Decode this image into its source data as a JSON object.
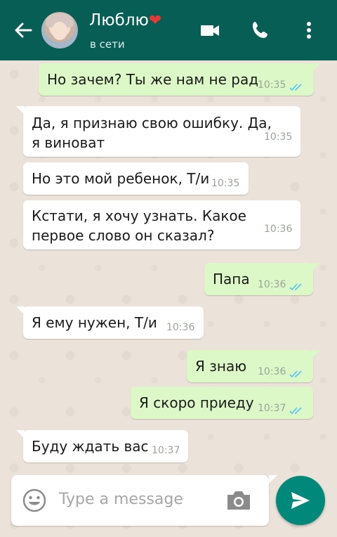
{
  "header": {
    "contact_name": "Люблю",
    "heart": "❤",
    "status": "в сети"
  },
  "messages": [
    {
      "dir": "out",
      "text": "Но зачем? Ты же нам не рад",
      "time": "10:35",
      "read": true
    },
    {
      "dir": "in",
      "text_lines": [
        "Да, я признаю свою ошибку. Да,",
        "я виноват"
      ],
      "time": "10:35"
    },
    {
      "dir": "in",
      "text": "Но это мой ребенок, Т/и",
      "time": "10:35"
    },
    {
      "dir": "in",
      "text_lines": [
        "Кстати, я хочу узнать. Какое",
        "первое слово он сказал?"
      ],
      "time": "10:36"
    },
    {
      "dir": "out",
      "text": "Папа",
      "time": "10:36",
      "read": true
    },
    {
      "dir": "in",
      "text": "Я ему нужен, Т/и",
      "time": "10:36"
    },
    {
      "dir": "out",
      "text": "Я знаю",
      "time": "10:36",
      "read": true
    },
    {
      "dir": "out",
      "text": "Я скоро приеду",
      "time": "10:37",
      "read": true
    },
    {
      "dir": "in",
      "text": "Буду ждать вас",
      "time": "10:37"
    }
  ],
  "composer": {
    "placeholder": "Type a message"
  },
  "colors": {
    "header": "#075e54",
    "incoming": "#ffffff",
    "outgoing": "#dcf8c6",
    "send_button": "#00897b",
    "read_ticks": "#4fc3f7"
  },
  "icons": [
    "back-arrow-icon",
    "video-call-icon",
    "phone-icon",
    "more-vert-icon",
    "emoji-icon",
    "camera-icon",
    "send-icon",
    "double-tick-icon"
  ]
}
